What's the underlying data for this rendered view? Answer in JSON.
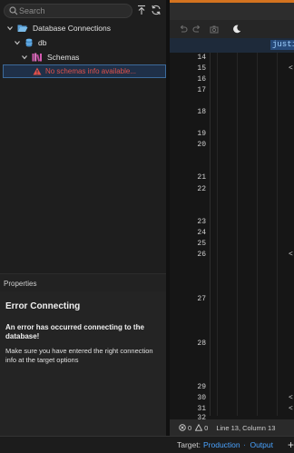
{
  "search": {
    "placeholder": "Search"
  },
  "tree": {
    "root_label": "Database Connections",
    "db_label": "db",
    "schemas_label": "Schemas",
    "error_label": "No schemas info available..."
  },
  "properties": {
    "header": "Properties",
    "title": "Error Connecting",
    "message": "An error has occurred connecting to the database!",
    "hint": "Make sure you have entered the right connection info at the target options"
  },
  "editor": {
    "selected_text": "justi",
    "line_numbers": [
      "14",
      "15",
      "16",
      "17",
      "18",
      "19",
      "20",
      "21",
      "22",
      "23",
      "24",
      "25",
      "26",
      "27",
      "28",
      "29",
      "30",
      "31",
      "32"
    ],
    "fragments": [
      "<",
      "<",
      "<",
      "<"
    ]
  },
  "status_bar": {
    "errors": "0",
    "warnings": "0",
    "cursor": "Line 13, Column 13"
  },
  "target_bar": {
    "label": "Target:",
    "target": "Production",
    "output": "Output",
    "add": "+"
  },
  "colors": {
    "accent": "#d4731f",
    "link": "#4aa3ff",
    "error": "#e0504a",
    "selection": "#1f3048"
  }
}
